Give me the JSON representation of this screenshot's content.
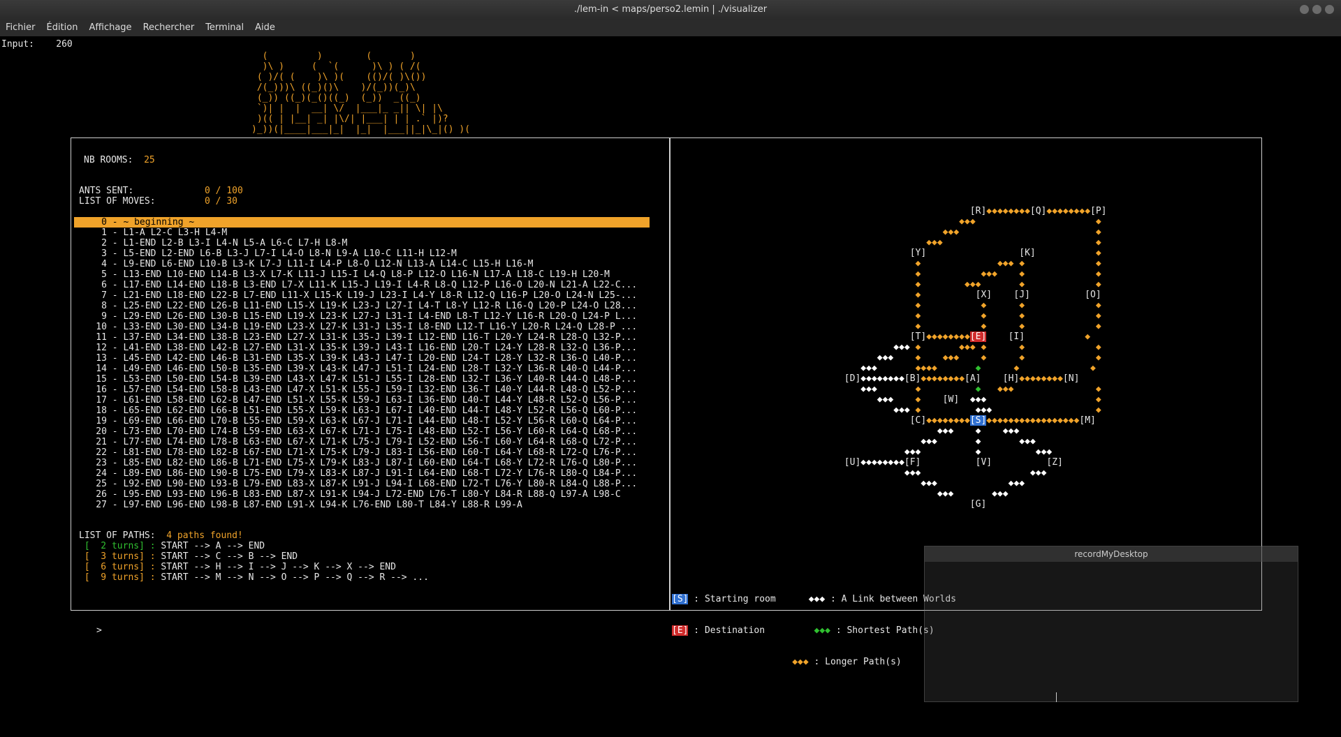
{
  "window": {
    "title": "./lem-in < maps/perso2.lemin | ./visualizer"
  },
  "menu": [
    "Fichier",
    "Édition",
    "Affichage",
    "Rechercher",
    "Terminal",
    "Aide"
  ],
  "input": {
    "label": "Input:",
    "value": "260"
  },
  "ascii_logo": [
    "  (         )        (       )",
    "  )\\ )     (  `(      )\\ ) ( /(",
    " ( )/( (    )\\ )(    (()/( )\\())",
    " /(_)))\\ ((_)()\\    )/(_))(_)\\",
    " (_)) ((_)(_()((_)  (_))  _((_)",
    " `)| |  |  __| \\/  |___|_ _|| \\| |\\",
    " )(( | |__| _| |\\/| |___| | | .` |)?",
    ")_))(|____|___|_|  |_|  |___||_|\\_|() )("
  ],
  "stats": {
    "nb_rooms_label": "NB ROOMS:",
    "nb_rooms_value": "25",
    "ants_sent_label": "ANTS SENT:",
    "ants_sent_value": "0 / 100",
    "moves_label": "LIST OF MOVES:",
    "moves_value": "0 / 30"
  },
  "moves": [
    "     0 - ~ beginning ~",
    "     1 - L1-A L2-C L3-H L4-M",
    "     2 - L1-END L2-B L3-I L4-N L5-A L6-C L7-H L8-M",
    "     3 - L5-END L2-END L6-B L3-J L7-I L4-O L8-N L9-A L10-C L11-H L12-M",
    "     4 - L9-END L6-END L10-B L3-K L7-J L11-I L4-P L8-O L12-N L13-A L14-C L15-H L16-M",
    "     5 - L13-END L10-END L14-B L3-X L7-K L11-J L15-I L4-Q L8-P L12-O L16-N L17-A L18-C L19-H L20-M",
    "     6 - L17-END L14-END L18-B L3-END L7-X L11-K L15-J L19-I L4-R L8-Q L12-P L16-O L20-N L21-A L22-C...",
    "     7 - L21-END L18-END L22-B L7-END L11-X L15-K L19-J L23-I L4-Y L8-R L12-Q L16-P L20-O L24-N L25-...",
    "     8 - L25-END L22-END L26-B L11-END L15-X L19-K L23-J L27-I L4-T L8-Y L12-R L16-Q L20-P L24-O L28...",
    "     9 - L29-END L26-END L30-B L15-END L19-X L23-K L27-J L31-I L4-END L8-T L12-Y L16-R L20-Q L24-P L...",
    "    10 - L33-END L30-END L34-B L19-END L23-X L27-K L31-J L35-I L8-END L12-T L16-Y L20-R L24-Q L28-P ...",
    "    11 - L37-END L34-END L38-B L23-END L27-X L31-K L35-J L39-I L12-END L16-T L20-Y L24-R L28-Q L32-P...",
    "    12 - L41-END L38-END L42-B L27-END L31-X L35-K L39-J L43-I L16-END L20-T L24-Y L28-R L32-Q L36-P...",
    "    13 - L45-END L42-END L46-B L31-END L35-X L39-K L43-J L47-I L20-END L24-T L28-Y L32-R L36-Q L40-P...",
    "    14 - L49-END L46-END L50-B L35-END L39-X L43-K L47-J L51-I L24-END L28-T L32-Y L36-R L40-Q L44-P...",
    "    15 - L53-END L50-END L54-B L39-END L43-X L47-K L51-J L55-I L28-END L32-T L36-Y L40-R L44-Q L48-P...",
    "    16 - L57-END L54-END L58-B L43-END L47-X L51-K L55-J L59-I L32-END L36-T L40-Y L44-R L48-Q L52-P...",
    "    17 - L61-END L58-END L62-B L47-END L51-X L55-K L59-J L63-I L36-END L40-T L44-Y L48-R L52-Q L56-P...",
    "    18 - L65-END L62-END L66-B L51-END L55-X L59-K L63-J L67-I L40-END L44-T L48-Y L52-R L56-Q L60-P...",
    "    19 - L69-END L66-END L70-B L55-END L59-X L63-K L67-J L71-I L44-END L48-T L52-Y L56-R L60-Q L64-P...",
    "    20 - L73-END L70-END L74-B L59-END L63-X L67-K L71-J L75-I L48-END L52-T L56-Y L60-R L64-Q L68-P...",
    "    21 - L77-END L74-END L78-B L63-END L67-X L71-K L75-J L79-I L52-END L56-T L60-Y L64-R L68-Q L72-P...",
    "    22 - L81-END L78-END L82-B L67-END L71-X L75-K L79-J L83-I L56-END L60-T L64-Y L68-R L72-Q L76-P...",
    "    23 - L85-END L82-END L86-B L71-END L75-X L79-K L83-J L87-I L60-END L64-T L68-Y L72-R L76-Q L80-P...",
    "    24 - L89-END L86-END L90-B L75-END L79-X L83-K L87-J L91-I L64-END L68-T L72-Y L76-R L80-Q L84-P...",
    "    25 - L92-END L90-END L93-B L79-END L83-X L87-K L91-J L94-I L68-END L72-T L76-Y L80-R L84-Q L88-P...",
    "    26 - L95-END L93-END L96-B L83-END L87-X L91-K L94-J L72-END L76-T L80-Y L84-R L88-Q L97-A L98-C",
    "    27 - L97-END L96-END L98-B L87-END L91-X L94-K L76-END L80-T L84-Y L88-R L99-A"
  ],
  "paths": {
    "label": "LIST OF PATHS:",
    "found": "4 paths found!",
    "items": [
      {
        "turns": " [  2 turns] :",
        "route": " START --> A --> END",
        "color": "#30c030"
      },
      {
        "turns": " [  3 turns] :",
        "route": " START --> C --> B --> END",
        "color": "#f0a32a"
      },
      {
        "turns": " [  6 turns] :",
        "route": " START --> H --> I --> J --> K --> X --> END",
        "color": "#f0a32a"
      },
      {
        "turns": " [  9 turns] :",
        "route": " START --> M --> N --> O --> P --> Q --> R --> ...",
        "color": "#f0a32a"
      }
    ]
  },
  "graph_rows": [
    "                              [R]◆◆◆◆◆◆◆◆[Q]◆◆◆◆◆◆◆◆[P]",
    "                            ◆◆◆                      ◆",
    "                         ◆◆◆                         ◆",
    "                      ◆◆◆                            ◆",
    "                   [Y]                 [K]           ◆",
    "                    ◆              ◆◆◆ ◆             ◆",
    "                    ◆           ◆◆◆    ◆             ◆",
    "                    ◆        ◆◆◆       ◆             ◆",
    "                    ◆          [X]    [J]          [O]",
    "                    ◆           ◆      ◆             ◆",
    "                    ◆           ◆      ◆             ◆",
    "                    ◆           ◆      ◆             ◆",
    "                   [T]◆◆◆◆◆◆◆◆[E]    [I]           ◆",
    "                ◆◆◆ ◆       ◆◆◆ ◆      ◆             ◆",
    "             ◆◆◆    ◆    ◆◆◆    ◆      ◆             ◆",
    "          ◆◆◆       ◆◆◆◆       ◆      ◆             ◆",
    "       [D]◆◆◆◆◆◆◆◆[B]◆◆◆◆◆◆◆◆[A]    [H]◆◆◆◆◆◆◆◆[N]",
    "          ◆◆◆       ◆          ◆   ◆◆◆               ◆",
    "             ◆◆◆    ◆    [W]  ◆◆◆                    ◆",
    "                ◆◆◆ ◆          ◆◆◆                   ◆",
    "                   [C]◆◆◆◆◆◆◆◆[S]◆◆◆◆◆◆◆◆◆◆◆◆◆◆◆◆◆[M]",
    "                        ◆◆◆    ◆    ◆◆◆",
    "                     ◆◆◆       ◆       ◆◆◆",
    "                  ◆◆◆          ◆          ◆◆◆",
    "       [U]◆◆◆◆◆◆◆◆[F]          [V]          [Z]",
    "                  ◆◆◆                    ◆◆◆",
    "                     ◆◆◆             ◆◆◆",
    "                        ◆◆◆       ◆◆◆",
    "                              [G]"
  ],
  "legend": {
    "start_mark": "[S]",
    "start_label": " : Starting room",
    "end_mark": "[E]",
    "end_label": " : Destination",
    "link_mark": "◆◆◆",
    "link_label": " : A Link between Worlds",
    "short_mark": "◆◆◆",
    "short_label": " : Shortest Path(s)",
    "long_mark": "◆◆◆",
    "long_label": " : Longer Path(s)"
  },
  "prompt": ">",
  "recorder": {
    "title": "recordMyDesktop"
  },
  "colors": {
    "accent": "#f0a32a",
    "shortest": "#30c030",
    "start": "#2f6fd0",
    "end": "#d02b2b"
  }
}
